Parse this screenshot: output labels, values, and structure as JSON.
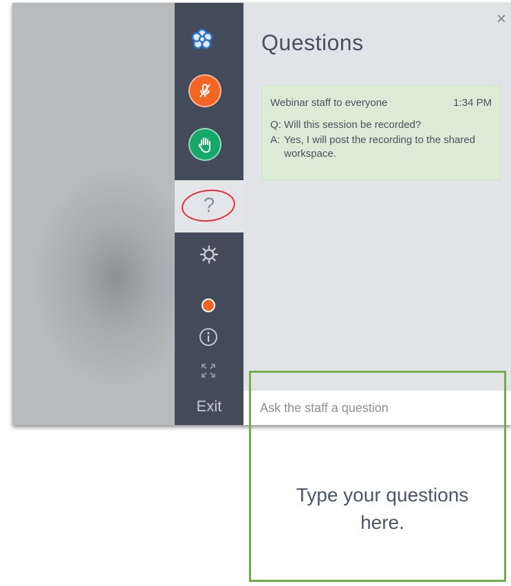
{
  "rail": {
    "logo_icon": "flower-logo-icon",
    "mic_icon": "microphone-muted-icon",
    "hand_icon": "raise-hand-icon",
    "help_label": "?",
    "gear_icon": "gear-icon",
    "record_icon": "record-dot-icon",
    "info_icon": "info-icon",
    "fullscreen_icon": "fullscreen-icon",
    "exit_label": "Exit"
  },
  "panel": {
    "title": "Questions",
    "close_label": "×",
    "messages": [
      {
        "from": "Webinar staff to everyone",
        "time": "1:34 PM",
        "q_tag": "Q:",
        "question": "Will this session be recorded?",
        "a_tag": "A:",
        "answer": "Yes, I will post the recording to the shared workspace."
      }
    ],
    "input": {
      "placeholder": "Ask the staff a question",
      "value": ""
    }
  },
  "annotation": {
    "text": "Type your questions here."
  },
  "colors": {
    "rail": "#434a5a",
    "mic": "#f26522",
    "hand": "#16a86b",
    "highlight_circle": "#e32a36",
    "callout_border": "#70ad47",
    "answer_card": "#dcebd6"
  }
}
